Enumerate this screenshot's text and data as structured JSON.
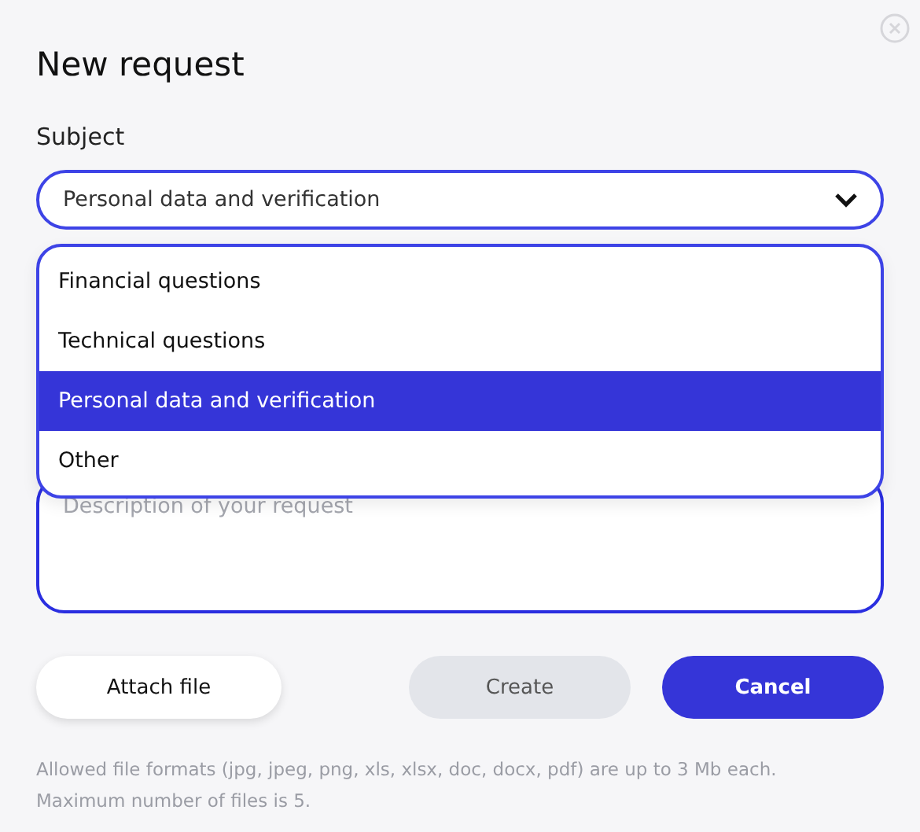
{
  "title": "New request",
  "subject": {
    "label": "Subject",
    "value": "Personal data and verification",
    "expanded": true,
    "options": [
      {
        "label": "Financial questions",
        "selected": false
      },
      {
        "label": "Technical questions",
        "selected": false
      },
      {
        "label": "Personal data and verification",
        "selected": true
      },
      {
        "label": "Other",
        "selected": false
      }
    ]
  },
  "description": {
    "placeholder": "Description of your request"
  },
  "buttons": [
    {
      "kind": "secondary",
      "label": "Attach file",
      "disabled": false
    },
    {
      "kind": "primary",
      "label": "Create",
      "disabled": true
    },
    {
      "kind": "primary",
      "label": "Cancel",
      "disabled": false
    }
  ],
  "note": [
    "Allowed file formats (jpg, jpeg, png, xls, xlsx, doc, docx, pdf) are up to 3 Mb each.",
    "Maximum number of files is 5."
  ]
}
